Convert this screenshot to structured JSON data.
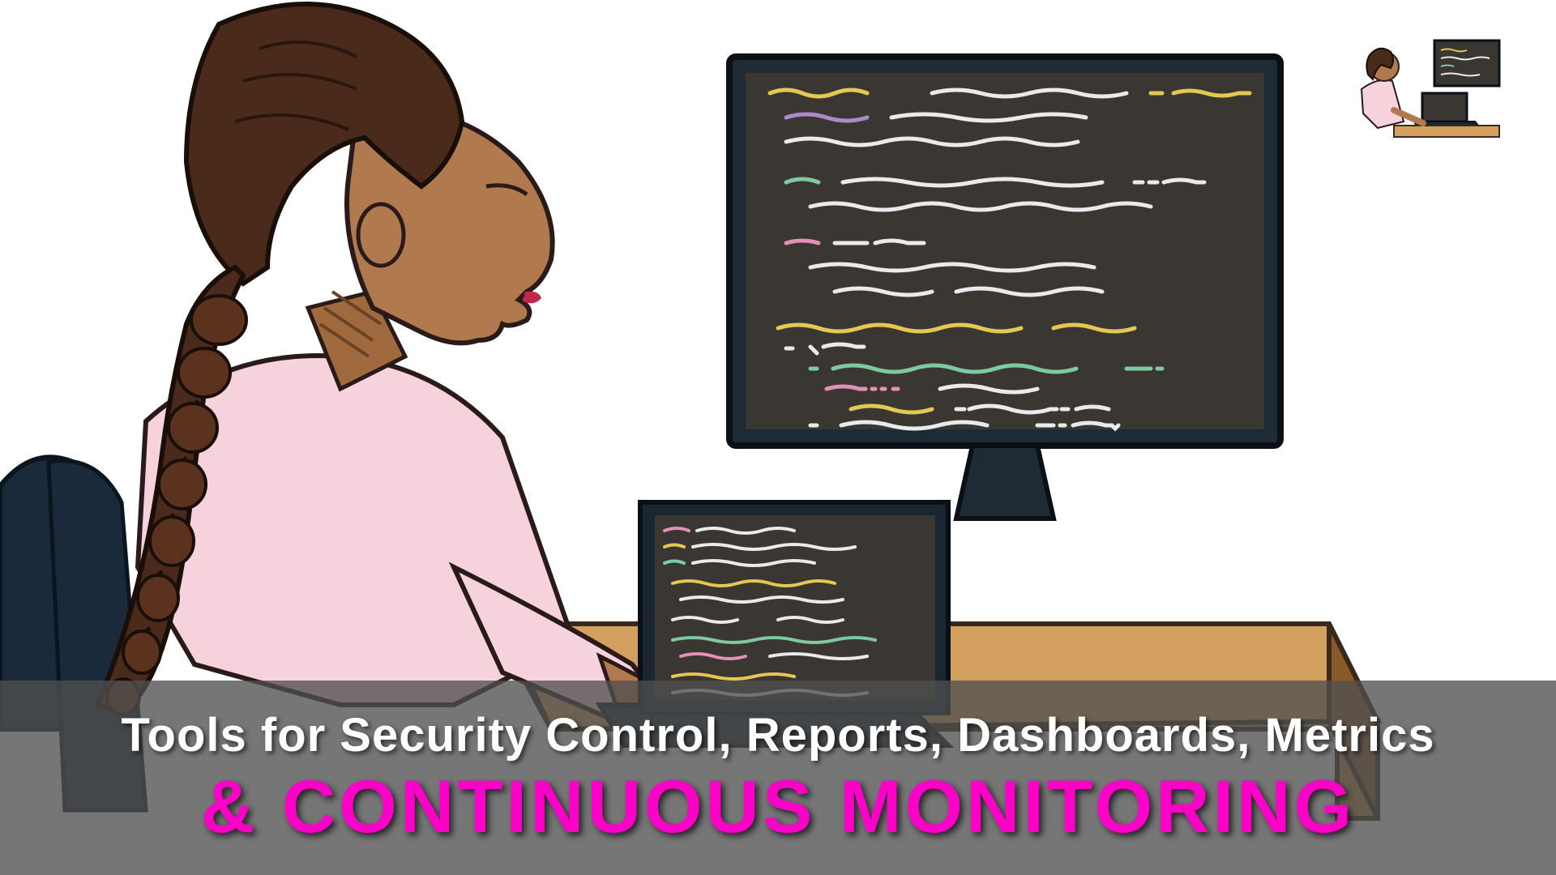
{
  "title": {
    "line1": "Tools for Security Control, Reports, Dashboards, Metrics",
    "line2": "& CONTINUOUS MONITORING"
  },
  "illustration": {
    "description": "woman-with-braid-coding-at-desk",
    "skin": "#b07a4e",
    "hair": "#4a2a1a",
    "shirt": "#f6d2dc",
    "desk": "#c08a4a",
    "chair": "#1a2a3a",
    "monitor_bg": "#3a3632",
    "code_colors": {
      "yellow": "#e5c851",
      "pink": "#e48fb5",
      "green": "#7fc9a0",
      "white": "#eaeaea",
      "purple": "#b088c8"
    }
  },
  "colors": {
    "banner_bg": "rgba(80,80,80,0.78)",
    "title_white": "#ffffff",
    "title_magenta": "#ff00c8"
  }
}
